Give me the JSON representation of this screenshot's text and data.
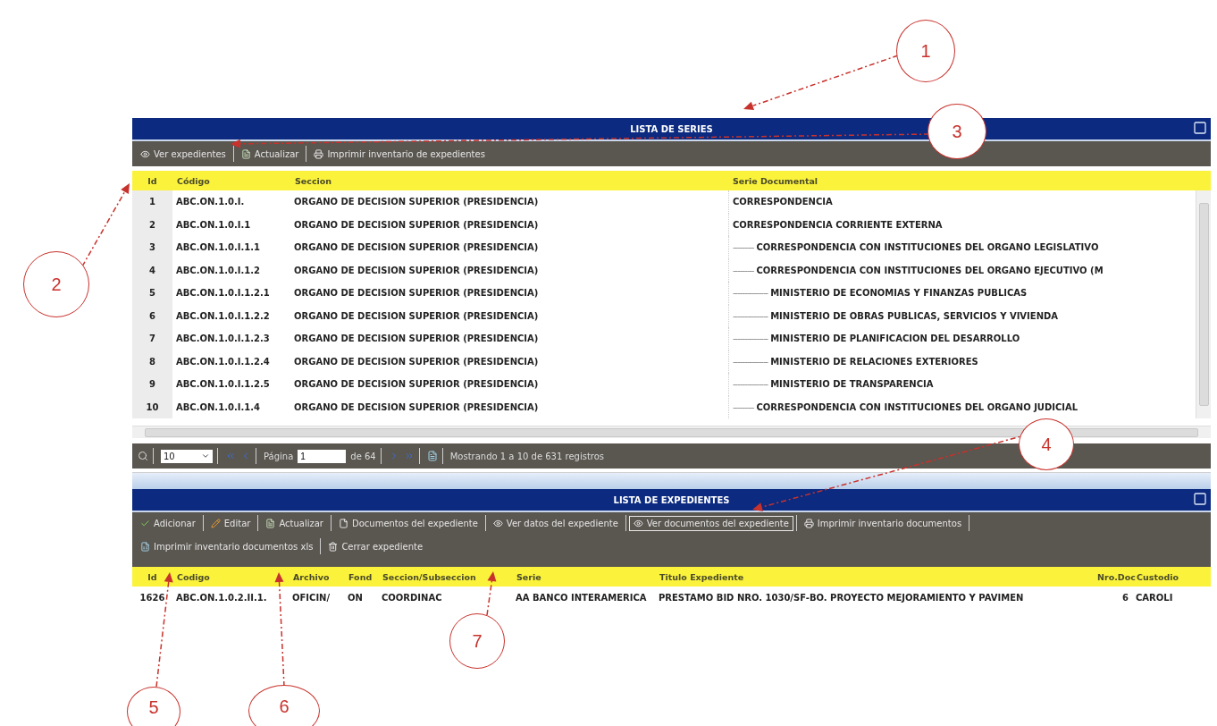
{
  "series_panel": {
    "title": "LISTA DE SERIES",
    "toolbar": [
      {
        "label": "Ver expedientes",
        "kind": "eye",
        "selected": false
      },
      {
        "label": "Actualizar",
        "kind": "sheet",
        "selected": false
      },
      {
        "label": "Imprimir inventario de expedientes",
        "kind": "printer",
        "selected": false
      }
    ],
    "columns": [
      "Id",
      "Código",
      "Seccion",
      "Serie Documental"
    ],
    "rows": [
      {
        "id": "1",
        "codigo": "ABC.ON.1.0.I.",
        "seccion": "ORGANO DE DECISION SUPERIOR (PRESIDENCIA)",
        "prefix": "",
        "serie": "CORRESPONDENCIA"
      },
      {
        "id": "2",
        "codigo": "ABC.ON.1.0.I.1",
        "seccion": "ORGANO DE DECISION SUPERIOR (PRESIDENCIA)",
        "prefix": "",
        "serie": "CORRESPONDENCIA CORRIENTE EXTERNA"
      },
      {
        "id": "3",
        "codigo": "ABC.ON.1.0.I.1.1",
        "seccion": "ORGANO DE DECISION SUPERIOR (PRESIDENCIA)",
        "prefix": "---------",
        "serie": "CORRESPONDENCIA CON INSTITUCIONES DEL ORGANO LEGISLATIVO"
      },
      {
        "id": "4",
        "codigo": "ABC.ON.1.0.I.1.2",
        "seccion": "ORGANO DE DECISION SUPERIOR (PRESIDENCIA)",
        "prefix": "---------",
        "serie": "CORRESPONDENCIA CON INSTITUCIONES DEL ORGANO EJECUTIVO (M"
      },
      {
        "id": "5",
        "codigo": "ABC.ON.1.0.I.1.2.1",
        "seccion": "ORGANO DE DECISION SUPERIOR (PRESIDENCIA)",
        "prefix": "---------------",
        "serie": "MINISTERIO DE ECONOMIAS Y FINANZAS PUBLICAS"
      },
      {
        "id": "6",
        "codigo": "ABC.ON.1.0.I.1.2.2",
        "seccion": "ORGANO DE DECISION SUPERIOR (PRESIDENCIA)",
        "prefix": "---------------",
        "serie": "MINISTERIO DE OBRAS PUBLICAS, SERVICIOS Y VIVIENDA"
      },
      {
        "id": "7",
        "codigo": "ABC.ON.1.0.I.1.2.3",
        "seccion": "ORGANO DE DECISION SUPERIOR (PRESIDENCIA)",
        "prefix": "---------------",
        "serie": "MINISTERIO DE PLANIFICACION DEL DESARROLLO"
      },
      {
        "id": "8",
        "codigo": "ABC.ON.1.0.I.1.2.4",
        "seccion": "ORGANO DE DECISION SUPERIOR (PRESIDENCIA)",
        "prefix": "---------------",
        "serie": "MINISTERIO DE RELACIONES EXTERIORES"
      },
      {
        "id": "9",
        "codigo": "ABC.ON.1.0.I.1.2.5",
        "seccion": "ORGANO DE DECISION SUPERIOR (PRESIDENCIA)",
        "prefix": "---------------",
        "serie": "MINISTERIO DE TRANSPARENCIA"
      },
      {
        "id": "10",
        "codigo": "ABC.ON.1.0.I.1.4",
        "seccion": "ORGANO DE DECISION SUPERIOR (PRESIDENCIA)",
        "prefix": "---------",
        "serie": "CORRESPONDENCIA CON INSTITUCIONES DEL ORGANO JUDICIAL"
      }
    ],
    "pager": {
      "page_size": "10",
      "page_label": "Página",
      "page": "1",
      "page_count": "de 64",
      "status": "Mostrando 1 a 10 de 631 registros"
    }
  },
  "expedientes_panel": {
    "title": "LISTA DE EXPEDIENTES",
    "toolbar": [
      {
        "label": "Adicionar",
        "kind": "check",
        "selected": false
      },
      {
        "label": "Editar",
        "kind": "pencil",
        "selected": false
      },
      {
        "label": "Actualizar",
        "kind": "sheet",
        "selected": false
      },
      {
        "label": "Documentos del expediente",
        "kind": "file",
        "selected": false
      },
      {
        "label": "Ver datos del expediente",
        "kind": "eye",
        "selected": false
      },
      {
        "label": "Ver documentos del expediente",
        "kind": "eye",
        "selected": true
      },
      {
        "label": "Imprimir inventario documentos",
        "kind": "printer",
        "selected": false
      },
      {
        "label": "Imprimir inventario documentos xls",
        "kind": "spreadsheet",
        "selected": false
      },
      {
        "label": "Cerrar expediente",
        "kind": "trash",
        "selected": false
      }
    ],
    "columns": [
      "Id",
      "Codigo",
      "Archivo",
      "Fond",
      "Seccion/Subseccion",
      "Serie",
      "Titulo Expediente",
      "Nro.Doc",
      "Custodio"
    ],
    "rows": [
      [
        "1626",
        "ABC.ON.1.0.2.II.1.",
        "OFICIN/",
        "ON",
        "COORDINAC",
        "AA BANCO INTERAMERICA",
        "PRESTAMO BID NRO. 1030/SF-BO. PROYECTO MEJORAMIENTO Y PAVIMEN",
        "6",
        "CAROLI"
      ]
    ]
  },
  "annotations": [
    {
      "label": "1"
    },
    {
      "label": "2"
    },
    {
      "label": "3"
    },
    {
      "label": "4"
    },
    {
      "label": "5"
    },
    {
      "label": "6"
    },
    {
      "label": "7"
    }
  ]
}
